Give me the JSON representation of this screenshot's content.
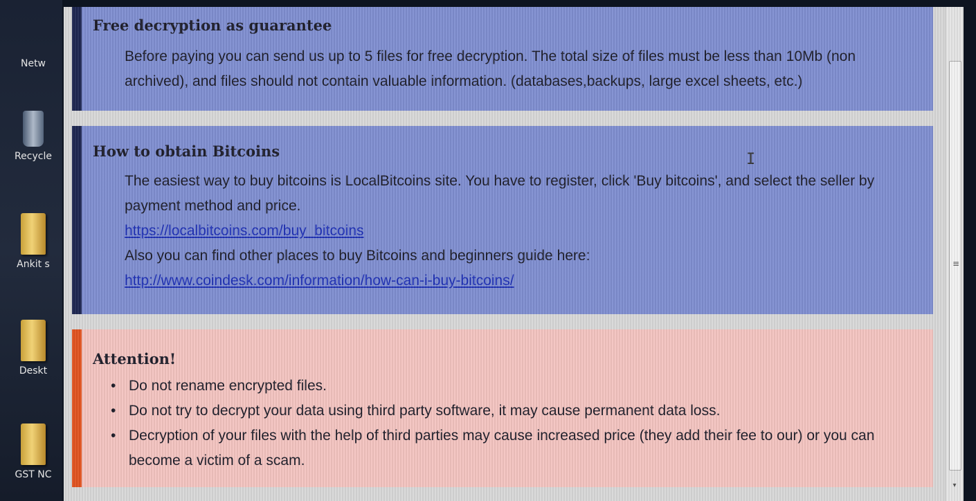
{
  "desktop": {
    "icons": [
      {
        "label": "Netw",
        "kind": "network"
      },
      {
        "label": "Recycle",
        "kind": "recycle-bin"
      },
      {
        "label": "Ankit s",
        "kind": "folder"
      },
      {
        "label": "Deskt",
        "kind": "folder"
      },
      {
        "label": "GST NC",
        "kind": "folder"
      }
    ]
  },
  "sections": {
    "free": {
      "title": "Free decryption as guarantee",
      "line1": "Before paying you can send us up to 5 files for free decryption. The total size of files must be less than 10Mb (non",
      "line2": "archived), and files should not contain valuable information. (databases,backups, large excel sheets, etc.)"
    },
    "bitcoins": {
      "title": "How to obtain Bitcoins",
      "line1": "The easiest way to buy bitcoins is LocalBitcoins site. You have to register, click 'Buy bitcoins', and select the seller by",
      "line2": "payment method and price.",
      "link1": "https://localbitcoins.com/buy_bitcoins",
      "line3": "Also you can find other places to buy Bitcoins and beginners guide here:",
      "link2": "http://www.coindesk.com/information/how-can-i-buy-bitcoins/"
    },
    "attention": {
      "title": "Attention!",
      "items": [
        "Do not rename encrypted files.",
        "Do not try to decrypt your data using third party software, it may cause permanent data loss.",
        "Decryption of your files with the help of third parties may cause increased price (they add their fee to our) or you can",
        "become a victim of a scam."
      ]
    }
  },
  "colors": {
    "blue_panel": "#7f8ed0",
    "pink_panel": "#f3c4c0",
    "attention_bar": "#e0521f",
    "link": "#1d2fb5"
  }
}
